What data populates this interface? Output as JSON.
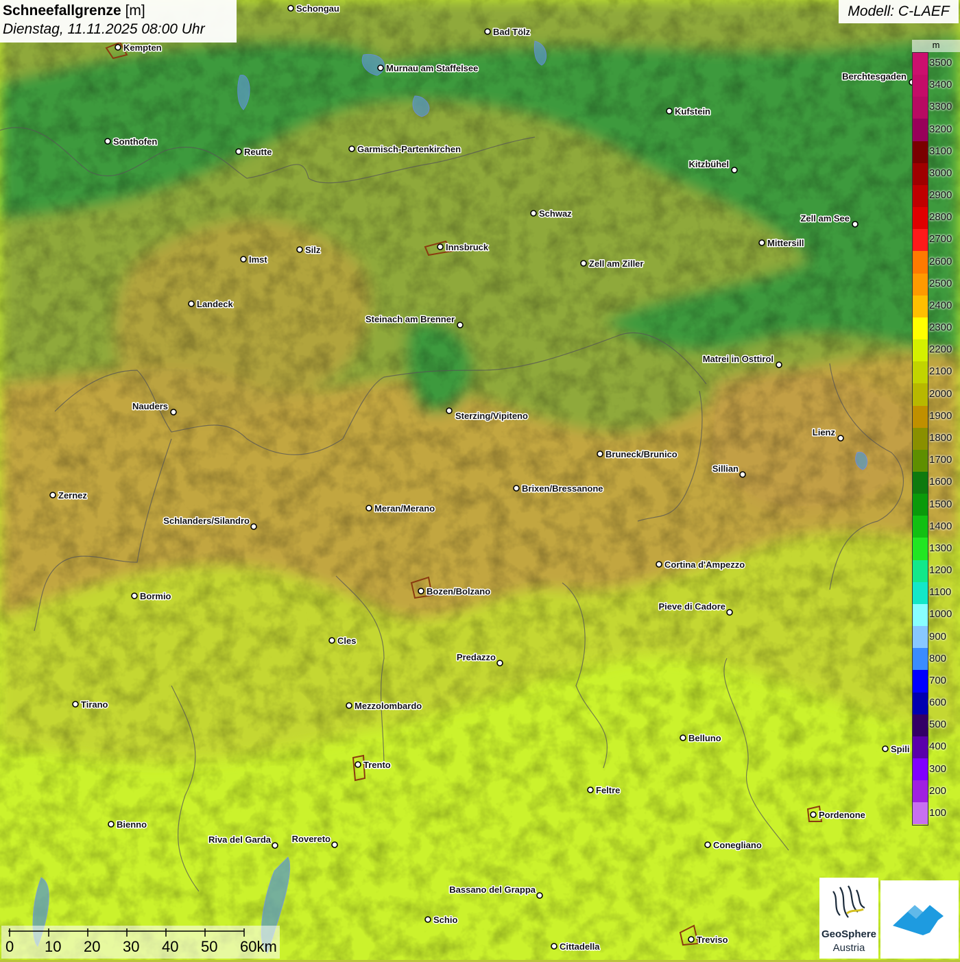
{
  "header": {
    "title": "Schneefallgrenze",
    "unit": "[m]",
    "datetime": "Dienstag, 11.11.2025 08:00 Uhr",
    "model": "Modell: C-LAEF"
  },
  "legend": {
    "unit": "m",
    "steps": [
      {
        "label": "3500",
        "color": "#cc0f6e"
      },
      {
        "label": "3400",
        "color": "#c40c68"
      },
      {
        "label": "3300",
        "color": "#b80a62"
      },
      {
        "label": "3200",
        "color": "#99005a"
      },
      {
        "label": "3100",
        "color": "#7a0000"
      },
      {
        "label": "3000",
        "color": "#a00000"
      },
      {
        "label": "2900",
        "color": "#c00000"
      },
      {
        "label": "2800",
        "color": "#e00000"
      },
      {
        "label": "2700",
        "color": "#ff1a1a"
      },
      {
        "label": "2600",
        "color": "#ff7a00"
      },
      {
        "label": "2500",
        "color": "#ff9a00"
      },
      {
        "label": "2400",
        "color": "#ffbf00"
      },
      {
        "label": "2300",
        "color": "#ffff00"
      },
      {
        "label": "2200",
        "color": "#d4f000"
      },
      {
        "label": "2100",
        "color": "#c2d400"
      },
      {
        "label": "2000",
        "color": "#b8b800"
      },
      {
        "label": "1900",
        "color": "#c09000"
      },
      {
        "label": "1800",
        "color": "#8a9000"
      },
      {
        "label": "1700",
        "color": "#5f8f00"
      },
      {
        "label": "1600",
        "color": "#0e7a0e"
      },
      {
        "label": "1500",
        "color": "#0a9a0a"
      },
      {
        "label": "1400",
        "color": "#12c012"
      },
      {
        "label": "1300",
        "color": "#22e622"
      },
      {
        "label": "1200",
        "color": "#12e88a"
      },
      {
        "label": "1100",
        "color": "#12e8c8"
      },
      {
        "label": "1000",
        "color": "#88ffff"
      },
      {
        "label": "900",
        "color": "#88c8ff"
      },
      {
        "label": "800",
        "color": "#3a8cff"
      },
      {
        "label": "700",
        "color": "#0000ff"
      },
      {
        "label": "600",
        "color": "#0000b0"
      },
      {
        "label": "500",
        "color": "#330066"
      },
      {
        "label": "400",
        "color": "#5a00aa"
      },
      {
        "label": "300",
        "color": "#8000ff"
      },
      {
        "label": "200",
        "color": "#a020e0"
      },
      {
        "label": "100",
        "color": "#c870f0"
      }
    ]
  },
  "cities": [
    {
      "name": "Schongau"
    },
    {
      "name": "Bad Tölz"
    },
    {
      "name": "Kempten"
    },
    {
      "name": "Murnau am Staffelsee"
    },
    {
      "name": "Berchtesgaden"
    },
    {
      "name": "Kufstein"
    },
    {
      "name": "Sonthofen"
    },
    {
      "name": "Reutte"
    },
    {
      "name": "Garmisch-Partenkirchen"
    },
    {
      "name": "Kitzbühel"
    },
    {
      "name": "Schwaz"
    },
    {
      "name": "Zell am See"
    },
    {
      "name": "Imst"
    },
    {
      "name": "Silz"
    },
    {
      "name": "Innsbruck"
    },
    {
      "name": "Mittersill"
    },
    {
      "name": "Zell am Ziller"
    },
    {
      "name": "Landeck"
    },
    {
      "name": "Steinach am Brenner"
    },
    {
      "name": "Matrei in Osttirol"
    },
    {
      "name": "Nauders"
    },
    {
      "name": "Sterzing/Vipiteno"
    },
    {
      "name": "Lienz"
    },
    {
      "name": "Bruneck/Brunico"
    },
    {
      "name": "Sillian"
    },
    {
      "name": "Zernez"
    },
    {
      "name": "Brixen/Bressanone"
    },
    {
      "name": "Meran/Merano"
    },
    {
      "name": "Schlanders/Silandro"
    },
    {
      "name": "Cortina d'Ampezzo"
    },
    {
      "name": "Bormio"
    },
    {
      "name": "Bozen/Bolzano"
    },
    {
      "name": "Pieve di Cadore"
    },
    {
      "name": "Cles"
    },
    {
      "name": "Predazzo"
    },
    {
      "name": "Tirano"
    },
    {
      "name": "Mezzolombardo"
    },
    {
      "name": "Belluno"
    },
    {
      "name": "Spili"
    },
    {
      "name": "Trento"
    },
    {
      "name": "Feltre"
    },
    {
      "name": "Pordenone"
    },
    {
      "name": "Bienno"
    },
    {
      "name": "Riva del Garda"
    },
    {
      "name": "Rovereto"
    },
    {
      "name": "Conegliano"
    },
    {
      "name": "Bassano del Grappa"
    },
    {
      "name": "Schio"
    },
    {
      "name": "Treviso"
    },
    {
      "name": "Cittadella"
    }
  ],
  "scale": {
    "labels": [
      "0",
      "10",
      "20",
      "30",
      "40",
      "50",
      "60km"
    ]
  },
  "logos": {
    "geosphere_line1": "GeoSphere",
    "geosphere_line2": "Austria"
  }
}
